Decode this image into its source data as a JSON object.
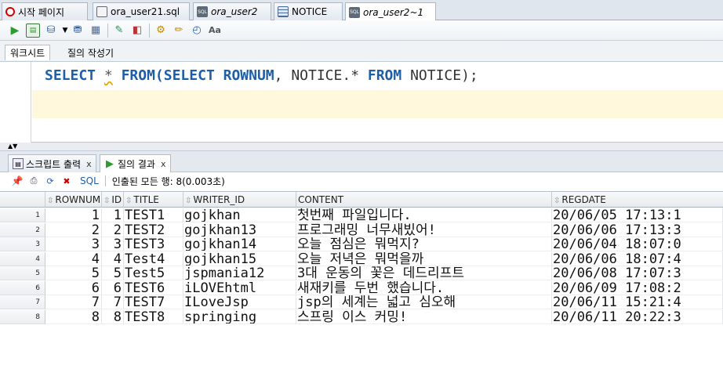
{
  "doc_tabs": [
    {
      "label": "시작 페이지",
      "icon": "oracle-icon",
      "active": false
    },
    {
      "label": "ora_user21.sql",
      "icon": "sql-file-icon",
      "active": false
    },
    {
      "label": "ora_user2",
      "icon": "sql-worksheet-icon",
      "active": false
    },
    {
      "label": "NOTICE",
      "icon": "table-icon",
      "active": false
    },
    {
      "label": "ora_user2~1",
      "icon": "sql-worksheet-icon",
      "active": true
    }
  ],
  "toolbar": {
    "icons": [
      "run-statement-icon",
      "run-script-icon",
      "commit-icon",
      "dropdown-icon",
      "rollback-icon",
      "explain-plan-icon",
      "autotrace-icon",
      "sql-tuning-icon",
      "unshared-sql-icon",
      "clear-icon",
      "history-icon",
      "format-icon"
    ]
  },
  "worksheet_tabs": [
    {
      "label": "워크시트",
      "active": true
    },
    {
      "label": "질의 작성기",
      "active": false
    }
  ],
  "editor": {
    "kw_select": "SELECT",
    "star": "*",
    "kw_from": "FROM",
    "paren_select": "(SELECT",
    "kw_rownum": "ROWNUM",
    "comma_notice": ", NOTICE.*",
    "kw_from2": "FROM",
    "tail": "NOTICE);"
  },
  "output_tabs": [
    {
      "label": "스크립트 출력",
      "close": "x",
      "icon": "script-output-icon",
      "active": false
    },
    {
      "label": "질의 결과",
      "close": "x",
      "icon": "query-result-icon",
      "active": true
    }
  ],
  "result_toolbar": {
    "sql_label": "SQL",
    "status": "인출된 모든 행: 8(0.003초)"
  },
  "grid": {
    "columns": [
      "ROWNUM",
      "ID",
      "TITLE",
      "WRITER_ID",
      "CONTENT",
      "REGDATE"
    ],
    "rows": [
      {
        "n": "1",
        "cells": [
          "1",
          "1",
          "TEST1",
          "gojkhan",
          "첫번째 파일입니다.",
          "20/06/05 17:13:1"
        ]
      },
      {
        "n": "2",
        "cells": [
          "2",
          "2",
          "TEST2",
          "gojkhan13",
          "프로그래밍 너무새빘어!",
          "20/06/06 17:13:3"
        ]
      },
      {
        "n": "3",
        "cells": [
          "3",
          "3",
          "TEST3",
          "gojkhan14",
          "오늘 점심은 뭐먹지?",
          "20/06/04 18:07:0"
        ]
      },
      {
        "n": "4",
        "cells": [
          "4",
          "4",
          "Test4",
          "gojkhan15",
          "오늘 저녁은 뭐먹을까",
          "20/06/06 18:07:4"
        ]
      },
      {
        "n": "5",
        "cells": [
          "5",
          "5",
          "Test5",
          "jspmania12",
          "3대 운동의 꽃은 데드리프트",
          "20/06/08 17:07:3"
        ]
      },
      {
        "n": "6",
        "cells": [
          "6",
          "6",
          "TEST6",
          "iLOVEhtml",
          "새재키를 두번 했습니다.",
          "20/06/09 17:08:2"
        ]
      },
      {
        "n": "7",
        "cells": [
          "7",
          "7",
          "TEST7",
          "ILoveJsp",
          "jsp의 세계는 넓고 심오해",
          "20/06/11 15:21:4"
        ]
      },
      {
        "n": "8",
        "cells": [
          "8",
          "8",
          "TEST8",
          "springing",
          "스프링 이스 커밍!",
          "20/06/11 20:22:3"
        ]
      }
    ]
  },
  "colors": {
    "keyword": "#1c5fa8",
    "current_line": "#fff8dc",
    "run_green": "#2e9b2e"
  }
}
